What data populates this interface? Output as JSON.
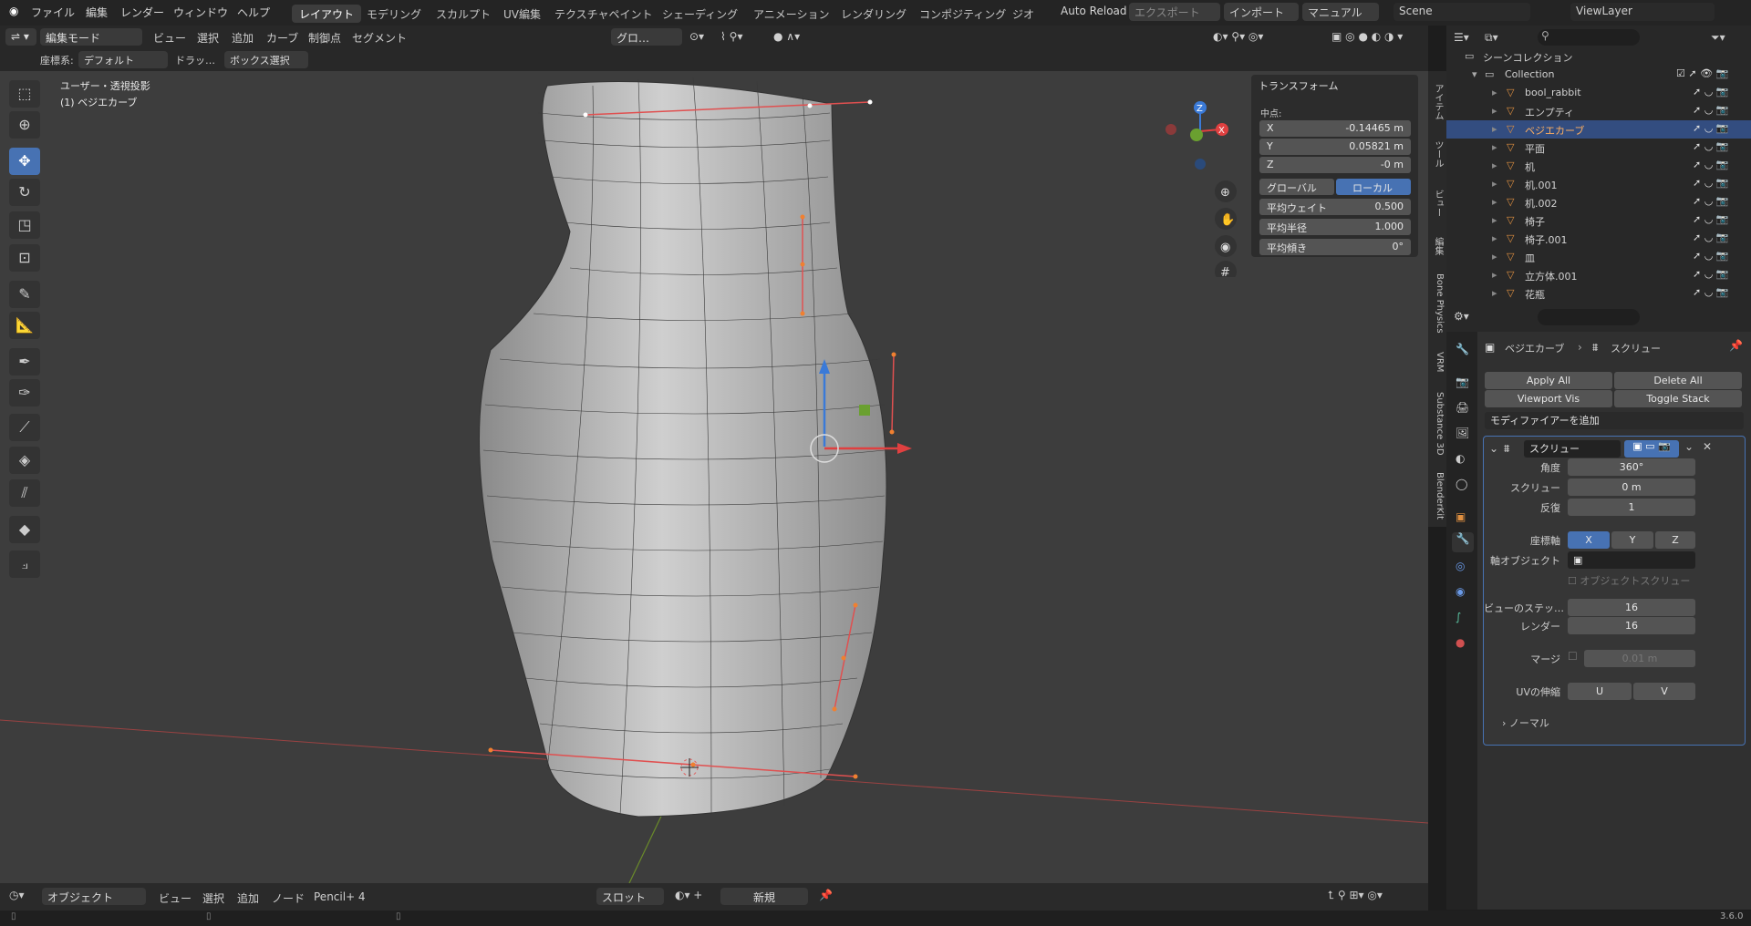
{
  "menu": {
    "file": "ファイル",
    "edit": "編集",
    "render": "レンダー",
    "window": "ウィンドウ",
    "help": "ヘルプ"
  },
  "workspaces": [
    "レイアウト",
    "モデリング",
    "スカルプト",
    "UV編集",
    "テクスチャペイント",
    "シェーディング",
    "アニメーション",
    "レンダリング",
    "コンポジティング",
    "ジオ"
  ],
  "header": {
    "auto_reload": "Auto Reload",
    "export": "エクスポート",
    "import": "インポート",
    "manual": "マニュアル",
    "scene": "Scene",
    "view_layer": "ViewLayer"
  },
  "vp_header": {
    "mode": "編集モード",
    "view": "ビュー",
    "select": "選択",
    "add": "追加",
    "curve": "カーブ",
    "control_point": "制御点",
    "segment": "セグメント",
    "transform_orient": "グロ…"
  },
  "vp_header2": {
    "coord_label": "座標系:",
    "coord_value": "デフォルト",
    "drag_label": "ドラッ…",
    "box_select": "ボックス選択"
  },
  "viewport": {
    "view_name": "ユーザー・透視投影",
    "object_name": "(1) ベジエカーブ"
  },
  "nprops": {
    "section": "トランスフォーム",
    "median_label": "中点:",
    "x_label": "X",
    "x_value": "-0.14465 m",
    "y_label": "Y",
    "y_value": "0.05821 m",
    "z_label": "Z",
    "z_value": "-0 m",
    "global": "グローバル",
    "local": "ローカル",
    "mean_weight_label": "平均ウェイト",
    "mean_weight": "0.500",
    "mean_radius_label": "平均半径",
    "mean_radius": "1.000",
    "mean_tilt_label": "平均傾き",
    "mean_tilt": "0°"
  },
  "side_tabs": [
    "アイテム",
    "ツール",
    "ビュー",
    "編集",
    "Bone Physics",
    "VRM",
    "Substance 3D",
    "BlenderKit"
  ],
  "outliner": {
    "scene_collection": "シーンコレクション",
    "collection": "Collection",
    "items": [
      "bool_rabbit",
      "エンプティ",
      "ベジエカーブ",
      "平面",
      "机",
      "机.001",
      "机.002",
      "椅子",
      "椅子.001",
      "皿",
      "立方体.001",
      "花瓶"
    ]
  },
  "props": {
    "breadcrumb_object": "ベジエカーブ",
    "breadcrumb_modifier": "スクリュー",
    "apply_all": "Apply All",
    "delete_all": "Delete All",
    "viewport_vis": "Viewport Vis",
    "toggle_stack": "Toggle Stack",
    "add_modifier": "モディファイアーを追加",
    "modifier_name": "スクリュー",
    "angle_label": "角度",
    "angle": "360°",
    "screw_label": "スクリュー",
    "screw": "0 m",
    "iterations_label": "反復",
    "iterations": "1",
    "axis_label": "座標軸",
    "axis_x": "X",
    "axis_y": "Y",
    "axis_z": "Z",
    "axis_object_label": "軸オブジェクト",
    "object_screw": "オブジェクトスクリュー",
    "viewport_steps_label": "ビューのステッ…",
    "viewport_steps": "16",
    "render_steps_label": "レンダー",
    "render_steps": "16",
    "merge_label": "マージ",
    "merge": "0.01 m",
    "uv_stretch_label": "UVの伸縮",
    "uv_u": "U",
    "uv_v": "V",
    "normals": "ノーマル"
  },
  "bottombar": {
    "mode": "オブジェクト",
    "view": "ビュー",
    "select": "選択",
    "add": "追加",
    "node": "ノード",
    "pencil": "Pencil+ 4",
    "slot": "スロット",
    "new": "新規"
  },
  "status": {
    "version": "3.6.0"
  },
  "colors": {
    "accent": "#4772b3",
    "selected_row": "#334d80",
    "viewport_bg": "#3d3d3d",
    "curve": "#e0504a"
  }
}
